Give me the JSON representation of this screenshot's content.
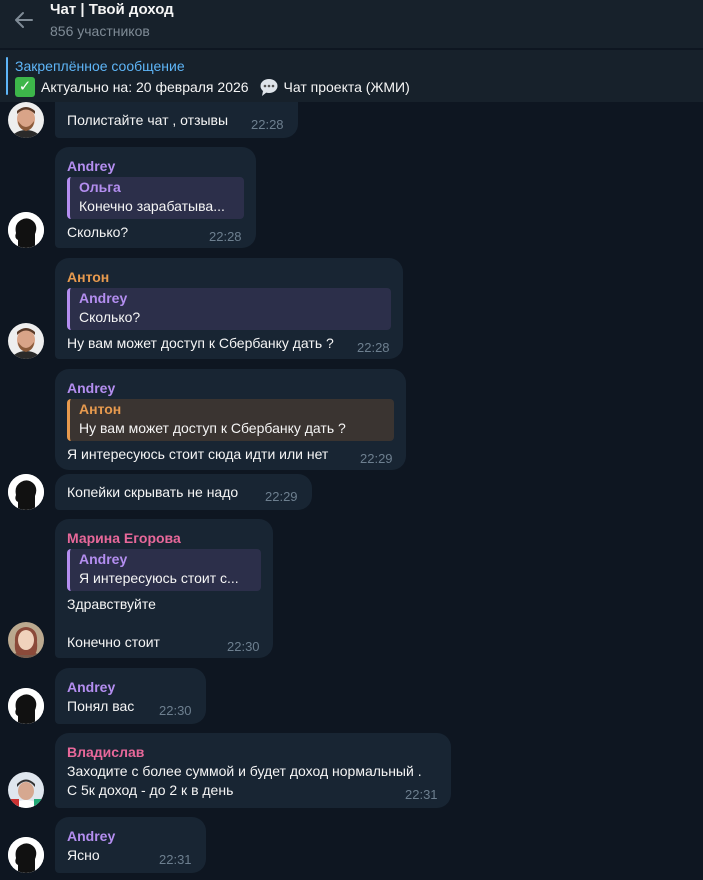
{
  "header": {
    "title": "Чат | Твой доход",
    "members": "856 участников"
  },
  "pinned": {
    "label": "Закреплённое сообщение",
    "text_part1": "Актуально на: 20 февраля 2026",
    "text_part2": "Чат проекта (ЖМИ)",
    "check_icon": "✓"
  },
  "colors": {
    "background": "#0e1621",
    "header": "#17212b",
    "bubble": "#182533",
    "accent": "#5eb5f7",
    "purple_author": "#b48ef0",
    "orange_author": "#e79a4e",
    "pink_author": "#e8689a"
  },
  "messages": [
    {
      "text": "Полистайте чат , отзывы",
      "time": "22:28"
    },
    {
      "author": "Andrey",
      "reply_author": "Ольга",
      "reply_text": "Конечно зарабатыва...",
      "text": "Сколько?",
      "time": "22:28"
    },
    {
      "author": "Антон",
      "reply_author": "Andrey",
      "reply_text": "Сколько?",
      "text": "Ну вам может доступ к Сбербанку дать ?",
      "time": "22:28"
    },
    {
      "author": "Andrey",
      "reply_author": "Антон",
      "reply_text": "Ну вам может доступ к Сбербанку дать ?",
      "text": "Я интересуюсь стоит сюда идти или нет",
      "time": "22:29"
    },
    {
      "text": "Копейки скрывать не надо",
      "time": "22:29"
    },
    {
      "author": "Марина Егорова",
      "reply_author": "Andrey",
      "reply_text": "Я интересуюсь стоит с...",
      "text": "Здравствуйте",
      "text2": "Конечно стоит",
      "time": "22:30"
    },
    {
      "author": "Andrey",
      "text": "Понял вас",
      "time": "22:30"
    },
    {
      "author": "Владислав",
      "text": "Заходите с более суммой и будет доход нормальный .",
      "text2": "С 5к доход - до 2 к в день",
      "time": "22:31"
    },
    {
      "author": "Andrey",
      "text": "Ясно",
      "time": "22:31"
    }
  ]
}
